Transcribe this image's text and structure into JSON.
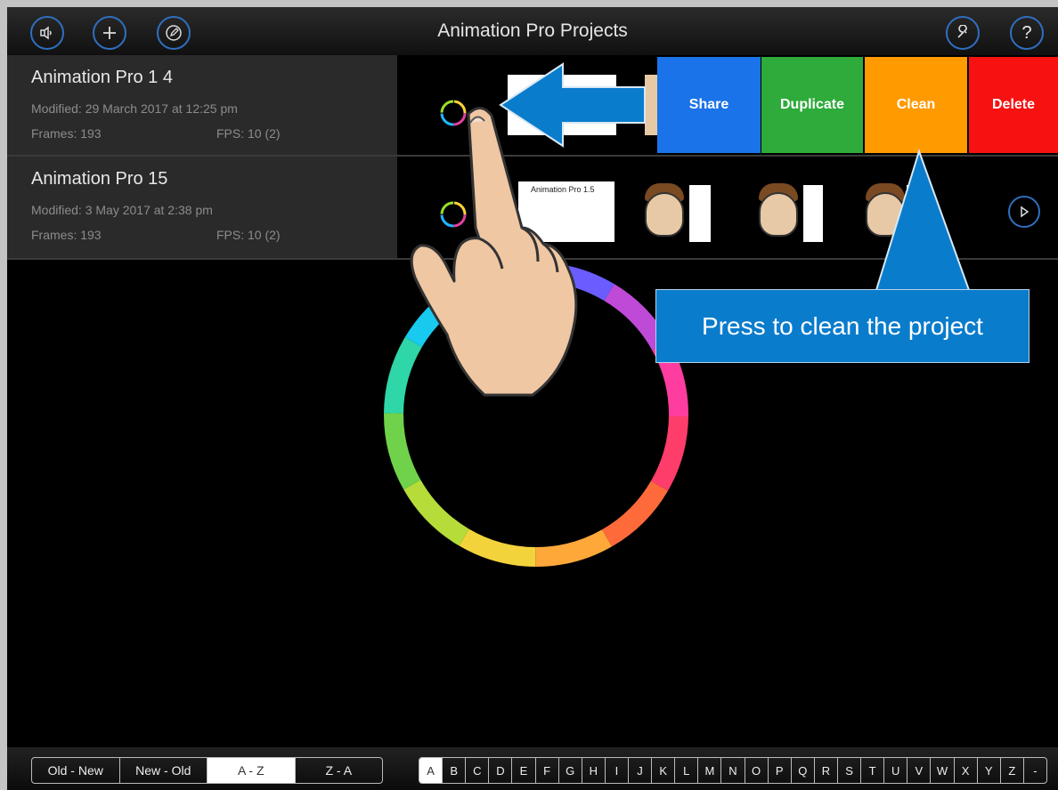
{
  "header": {
    "title": "Animation Pro Projects"
  },
  "toolbar": {
    "left_icons": [
      "speaker-icon",
      "plus-icon",
      "edit-icon"
    ],
    "right_icons": [
      "wrench-icon",
      "help-icon"
    ],
    "help_label": "?"
  },
  "projects": [
    {
      "name": "Animation Pro 1 4",
      "modified": "Modified: 29 March 2017 at 12:25 pm",
      "frames": "Frames: 193",
      "fps": "FPS: 10 (2)"
    },
    {
      "name": "Animation Pro 15",
      "modified": "Modified: 3 May 2017 at 2:38 pm",
      "frames": "Frames: 193",
      "fps": "FPS: 10 (2)",
      "thumb_title": "Animation Pro 1.5"
    }
  ],
  "swipe_actions": [
    {
      "label": "Share",
      "color": "#1a73e8"
    },
    {
      "label": "Duplicate",
      "color": "#2eab3b"
    },
    {
      "label": "Clean",
      "color": "#ff9a00"
    },
    {
      "label": "Delete",
      "color": "#f71111"
    }
  ],
  "annotation": {
    "callout_text": "Press to clean the project",
    "callout_color": "#0a7ccc"
  },
  "sort_options": [
    "Old - New",
    "New - Old",
    "A - Z",
    "Z - A"
  ],
  "sort_selected": "A - Z",
  "alphabet": [
    "A",
    "B",
    "C",
    "D",
    "E",
    "F",
    "G",
    "H",
    "I",
    "J",
    "K",
    "L",
    "M",
    "N",
    "O",
    "P",
    "Q",
    "R",
    "S",
    "T",
    "U",
    "V",
    "W",
    "X",
    "Y",
    "Z",
    "-"
  ],
  "alphabet_selected": "A"
}
